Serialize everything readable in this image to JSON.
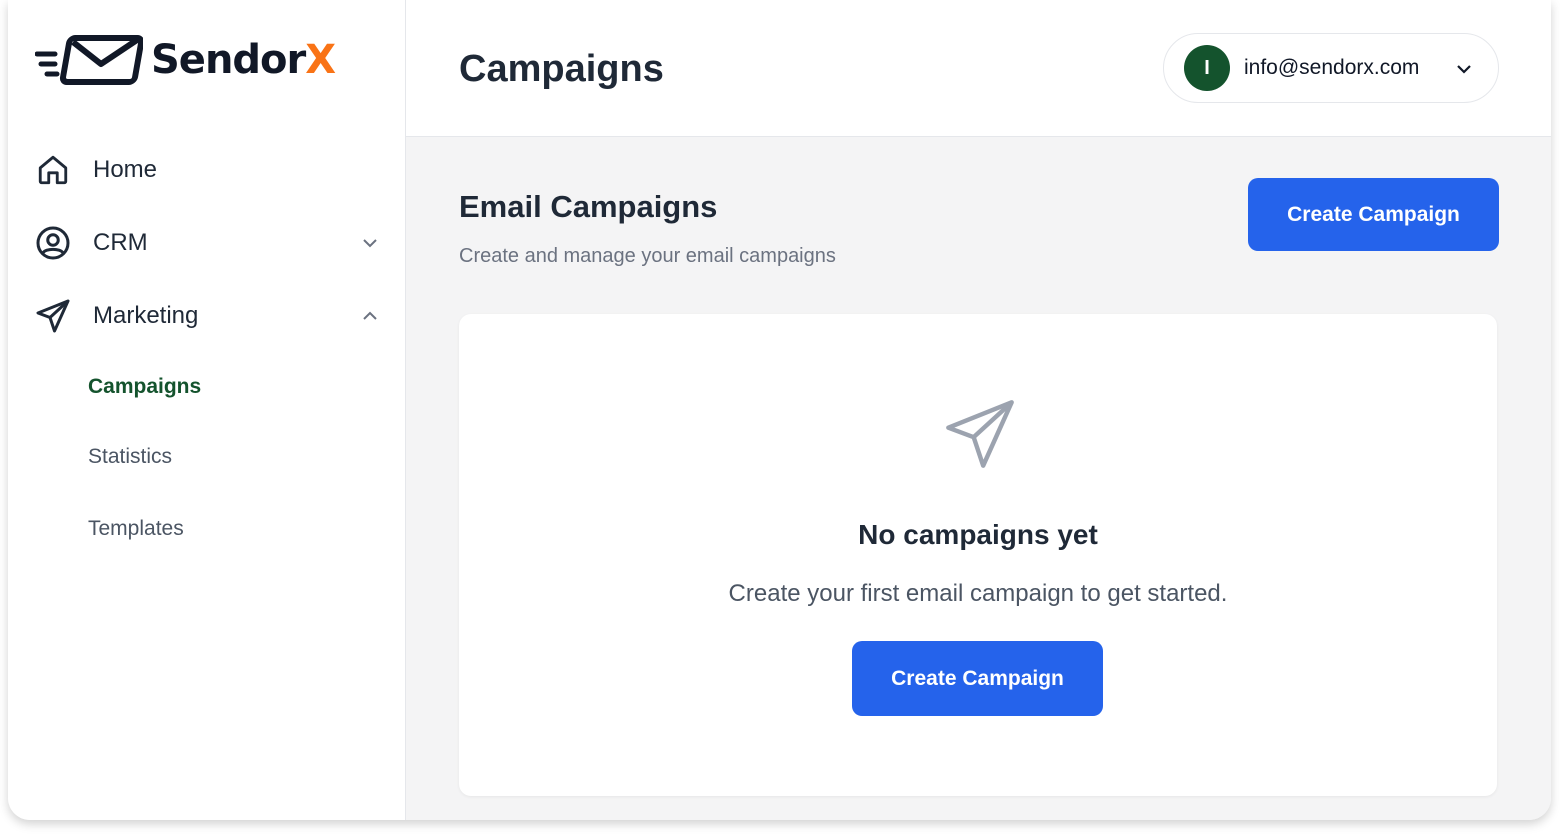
{
  "brand": {
    "name": "Sendor",
    "name_accent": "X",
    "accent_color": "#f97316"
  },
  "sidebar": {
    "items": [
      {
        "label": "Home",
        "icon": "home-icon"
      },
      {
        "label": "CRM",
        "icon": "user-circle-icon",
        "expanded": false
      },
      {
        "label": "Marketing",
        "icon": "send-icon",
        "expanded": true
      }
    ],
    "marketing_subitems": [
      {
        "label": "Campaigns",
        "active": true
      },
      {
        "label": "Statistics",
        "active": false
      },
      {
        "label": "Templates",
        "active": false
      }
    ]
  },
  "header": {
    "title": "Campaigns",
    "account": {
      "avatar_initial": "I",
      "email": "info@sendorx.com",
      "avatar_color": "#14532d"
    }
  },
  "main": {
    "section_title": "Email Campaigns",
    "section_subtitle": "Create and manage your email campaigns",
    "create_button_label": "Create Campaign",
    "primary_color": "#2563eb",
    "empty_state": {
      "icon": "paper-plane-icon",
      "title": "No campaigns yet",
      "subtitle": "Create your first email campaign to get started.",
      "button_label": "Create Campaign"
    }
  }
}
